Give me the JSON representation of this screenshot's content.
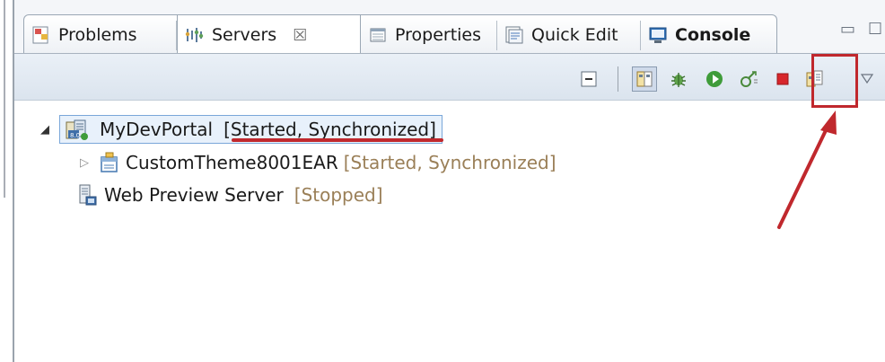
{
  "tabs": [
    {
      "label": "Problems",
      "icon": "problems-icon"
    },
    {
      "label": "Servers",
      "icon": "servers-icon",
      "active": true,
      "close": "☒"
    },
    {
      "label": "Properties",
      "icon": "properties-icon"
    },
    {
      "label": "Quick Edit",
      "icon": "quick-edit-icon"
    },
    {
      "label": "Console",
      "icon": "console-icon",
      "bold": true
    }
  ],
  "toolbar": {
    "buttons": [
      "collapse-all-icon",
      "publish-icon",
      "debug-icon",
      "start-icon",
      "profile-icon",
      "stop-icon",
      "publish-to-server-icon"
    ]
  },
  "tree": [
    {
      "label": "MyDevPortal",
      "status": "[Started, Synchronized]",
      "icon": "portal-server-icon",
      "expander": "open",
      "selected": true
    },
    {
      "label": "CustomTheme8001EAR",
      "status": "[Started, Synchronized]",
      "icon": "ear-module-icon",
      "expander": "closed"
    },
    {
      "label": "Web Preview Server",
      "status": "[Stopped]",
      "icon": "web-preview-server-icon",
      "expander": "none"
    }
  ],
  "annotation": {
    "highlight_color": "#c0282d"
  }
}
